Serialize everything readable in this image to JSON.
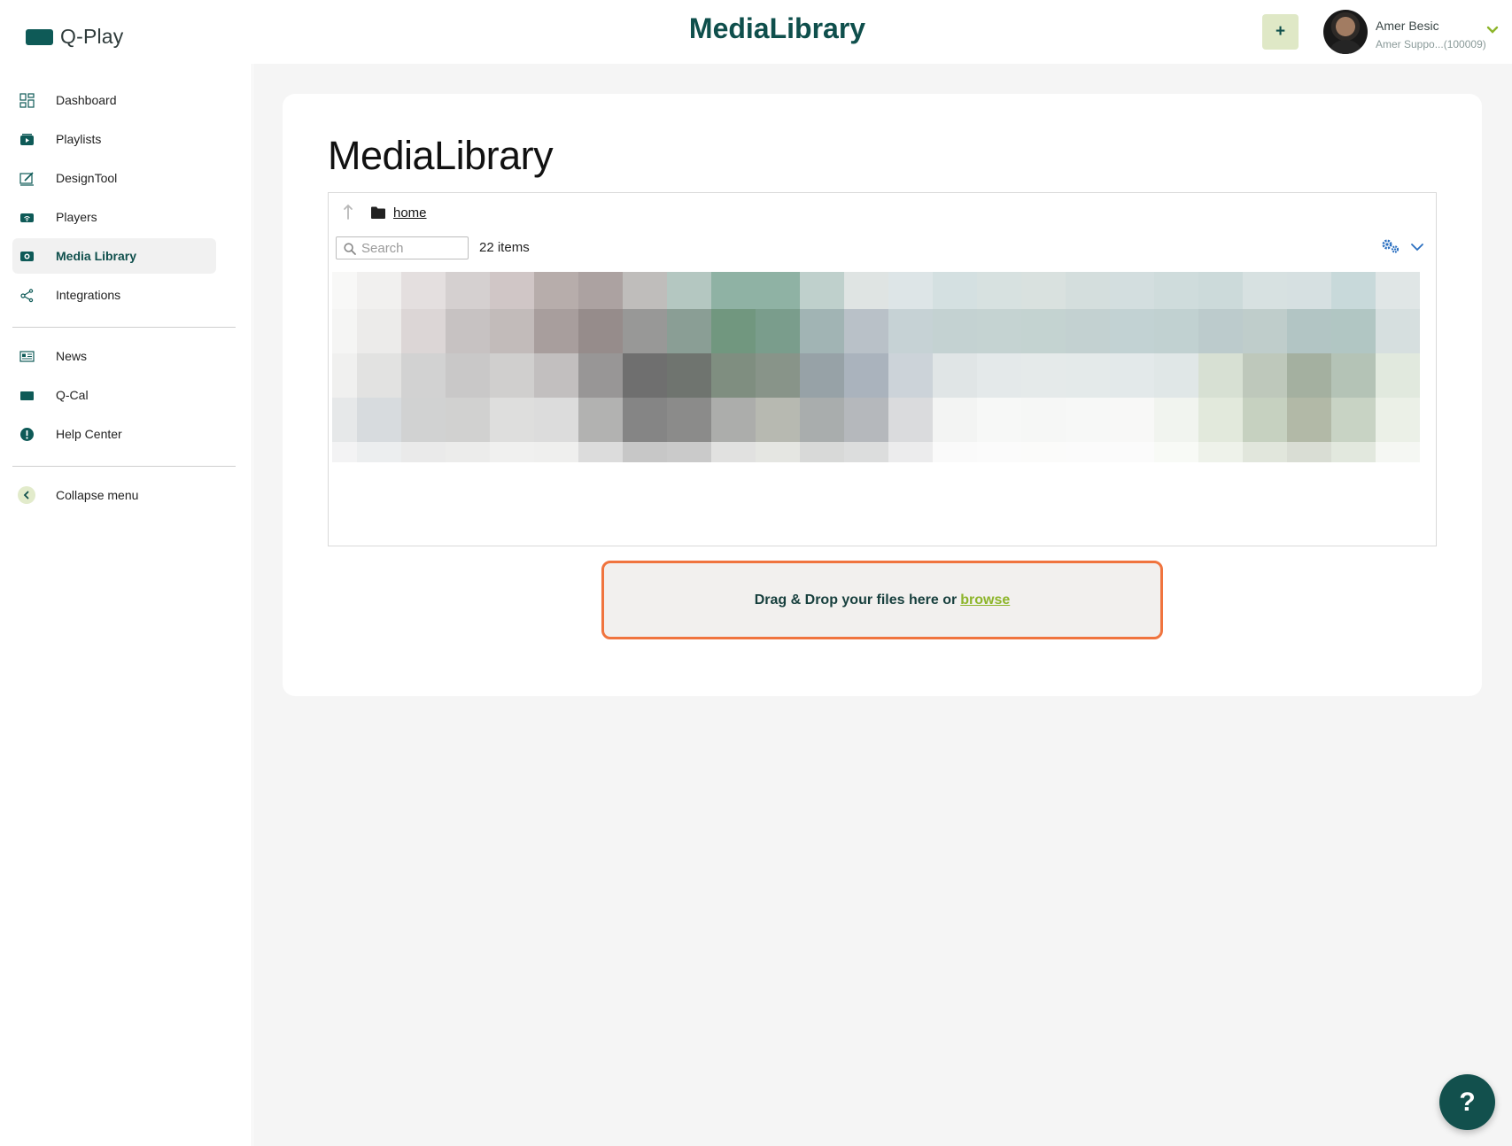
{
  "app": {
    "logo_text": "Q-Play",
    "page_header": "MediaLibrary"
  },
  "header": {
    "add_label": "+",
    "user_name": "Amer Besic",
    "user_org": "Amer Suppo...(100009)"
  },
  "sidebar": {
    "items": [
      {
        "label": "Dashboard",
        "icon": "dashboard-icon"
      },
      {
        "label": "Playlists",
        "icon": "playlist-icon"
      },
      {
        "label": "DesignTool",
        "icon": "design-tool-icon"
      },
      {
        "label": "Players",
        "icon": "player-icon"
      },
      {
        "label": "Media Library",
        "icon": "media-library-icon",
        "active": true
      },
      {
        "label": "Integrations",
        "icon": "share-icon"
      }
    ],
    "secondary": [
      {
        "label": "News",
        "icon": "news-icon"
      },
      {
        "label": "Q-Cal",
        "icon": "calendar-icon"
      },
      {
        "label": "Help Center",
        "icon": "alert-icon"
      }
    ],
    "collapse_label": "Collapse menu"
  },
  "main": {
    "title": "MediaLibrary",
    "breadcrumb": "home",
    "search_placeholder": "Search",
    "item_count": "22 items",
    "dropzone_text": "Drag & Drop your files here or",
    "dropzone_link": "browse"
  },
  "help_fab_label": "?",
  "colors": {
    "brand": "#0f4f4c",
    "accent_lime": "#8db52a",
    "dropzone_border": "#f0743e"
  }
}
